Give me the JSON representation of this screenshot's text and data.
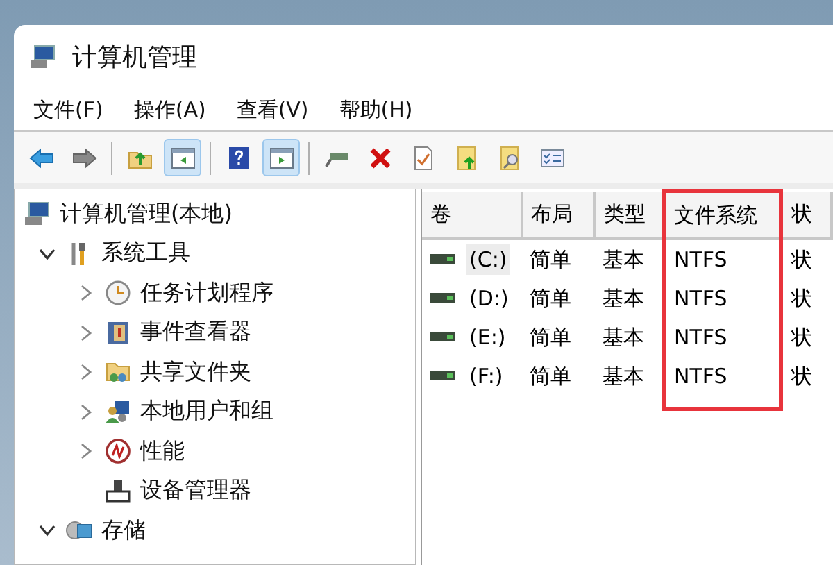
{
  "window": {
    "title": "计算机管理"
  },
  "menu": [
    "文件(F)",
    "操作(A)",
    "查看(V)",
    "帮助(H)"
  ],
  "toolbar": [
    [
      {
        "pressed": false
      },
      {
        "pressed": false
      }
    ],
    [
      {
        "pressed": false
      },
      {
        "pressed": true
      }
    ],
    [
      {
        "pressed": false
      },
      {
        "pressed": true
      }
    ],
    [
      {
        "pressed": false
      },
      {
        "pressed": false
      },
      {
        "pressed": false
      },
      {
        "pressed": false
      },
      {
        "pressed": false
      },
      {
        "pressed": false
      }
    ]
  ],
  "tree": [
    {
      "label": "计算机管理(本地)",
      "chevron": false,
      "children": [
        {
          "label": "系统工具",
          "chevron": true,
          "expanded": true,
          "children": [
            {
              "label": "任务计划程序",
              "chevron": true,
              "expanded": false
            },
            {
              "label": "事件查看器",
              "chevron": true,
              "expanded": false
            },
            {
              "label": "共享文件夹",
              "chevron": true,
              "expanded": false
            },
            {
              "label": "本地用户和组",
              "chevron": true,
              "expanded": false
            },
            {
              "label": "性能",
              "chevron": true,
              "expanded": false
            },
            {
              "label": "设备管理器",
              "chevron": false,
              "expanded": false
            }
          ]
        },
        {
          "label": "存储",
          "chevron": true,
          "expanded": true
        }
      ]
    }
  ],
  "table": {
    "columns": [
      {
        "label": "卷",
        "highlighted": false
      },
      {
        "label": "布局",
        "highlighted": false
      },
      {
        "label": "类型",
        "highlighted": false
      },
      {
        "label": "文件系统",
        "highlighted": true
      },
      {
        "label": "状",
        "highlighted": false
      }
    ],
    "rows": [
      {
        "selected": true,
        "cells": [
          "(C:)",
          "简单",
          "基本",
          "NTFS",
          "状"
        ]
      },
      {
        "selected": false,
        "cells": [
          "(D:)",
          "简单",
          "基本",
          "NTFS",
          "状"
        ]
      },
      {
        "selected": false,
        "cells": [
          "(E:)",
          "简单",
          "基本",
          "NTFS",
          "状"
        ]
      },
      {
        "selected": false,
        "cells": [
          "(F:)",
          "简单",
          "基本",
          "NTFS",
          "状"
        ]
      }
    ]
  }
}
